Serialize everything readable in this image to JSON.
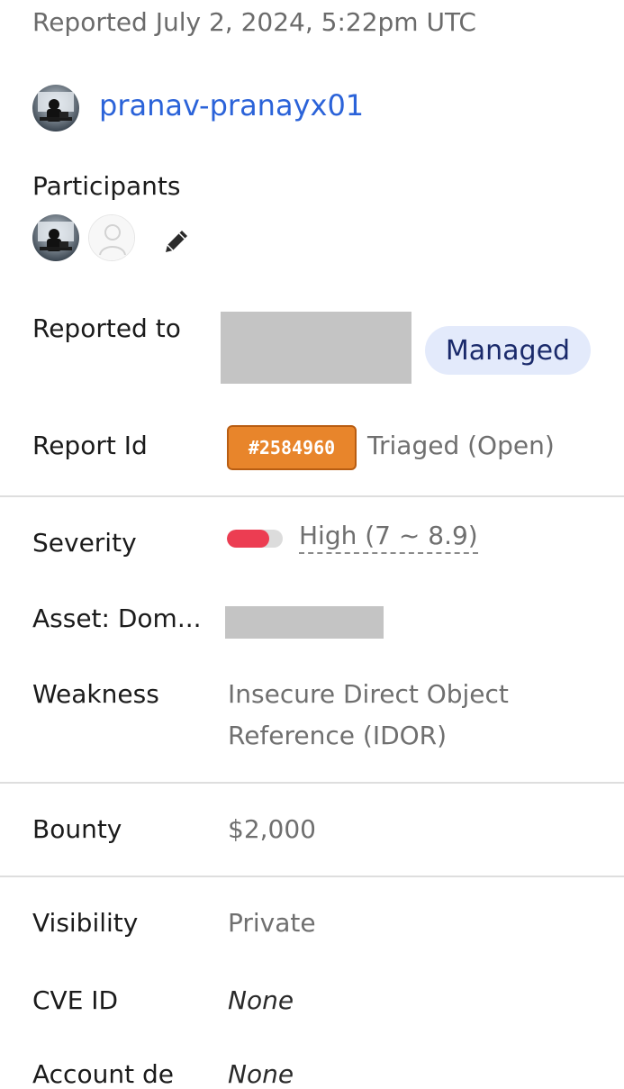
{
  "report": {
    "reported_text": "Reported July 2, 2024, 5:22pm UTC",
    "reporter": "pranav-pranayx01"
  },
  "participants": {
    "label": "Participants"
  },
  "details": {
    "reported_to_label": "Reported to",
    "managed_badge": "Managed",
    "report_id_label": "Report Id",
    "report_id": "#2584960",
    "report_status": "Triaged (Open)",
    "severity_label": "Severity",
    "severity_value": "High (7 ~ 8.9)",
    "severity_level": 0.75,
    "asset_label": "Asset: Dom...",
    "weakness_label": "Weakness",
    "weakness_line1": "Insecure Direct Object",
    "weakness_line2": "Reference (IDOR)",
    "bounty_label": "Bounty",
    "bounty_value": "$2,000",
    "visibility_label": "Visibility",
    "visibility_value": "Private",
    "cve_label": "CVE ID",
    "cve_value": "None",
    "account_label": "Account de",
    "account_value": "None"
  },
  "colors": {
    "link": "#2b63d9",
    "managed_bg": "#e3eafb",
    "report_id_bg": "#e8852b",
    "severity_high": "#ec3d52"
  },
  "icons": {
    "edit": "pencil-icon",
    "default_avatar": "user-silhouette-icon"
  }
}
